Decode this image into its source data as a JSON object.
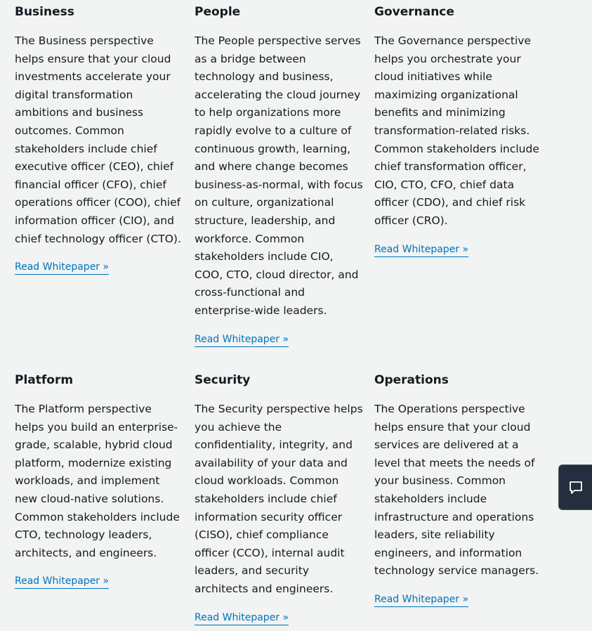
{
  "link_label": "Read Whitepaper »",
  "perspectives": [
    {
      "title": "Business",
      "description": "The Business perspective helps ensure that your cloud investments accelerate your digital transformation ambitions and business outcomes. Common stakeholders include chief executive officer (CEO), chief financial officer (CFO), chief operations officer (COO), chief information officer (CIO), and chief technology officer (CTO).",
      "link": "Read Whitepaper »"
    },
    {
      "title": "People",
      "description": "The People perspective serves as a bridge between technology and business, accelerating the cloud journey to help organizations more rapidly evolve to a culture of continuous growth, learning, and where change becomes business-as-normal, with focus on culture, organizational structure, leadership, and workforce. Common stakeholders include CIO, COO, CTO, cloud director, and cross-functional and enterprise-wide leaders.",
      "link": "Read Whitepaper »"
    },
    {
      "title": "Governance",
      "description": "The Governance perspective helps you orchestrate your cloud initiatives while maximizing organizational benefits and minimizing transformation-related risks. Common stakeholders include chief transformation officer, CIO, CTO, CFO, chief data officer (CDO), and chief risk officer (CRO).",
      "link": "Read Whitepaper »"
    },
    {
      "title": "Platform",
      "description": "The Platform perspective helps you build an enterprise-grade, scalable, hybrid cloud platform, modernize existing workloads, and implement new cloud-native solutions. Common stakeholders include CTO, technology leaders, architects, and engineers.",
      "link": "Read Whitepaper »"
    },
    {
      "title": "Security",
      "description": "The Security perspective helps you achieve the confidentiality, integrity, and availability of your data and cloud workloads. Common stakeholders include chief information security officer (CISO), chief compliance officer (CCO), internal audit leaders, and security architects and engineers.",
      "link": "Read Whitepaper »"
    },
    {
      "title": "Operations",
      "description": "The Operations perspective helps ensure that your cloud services are delivered at a level that meets the needs of your business. Common stakeholders include infrastructure and operations leaders, site reliability engineers, and information technology service managers.",
      "link": "Read Whitepaper »"
    }
  ],
  "chat_widget": {
    "icon": "chat-bubble-icon",
    "background": "#232f3e"
  },
  "colors": {
    "page_background": "#f2f3f3",
    "text": "#16191f",
    "link": "#0073bb"
  }
}
